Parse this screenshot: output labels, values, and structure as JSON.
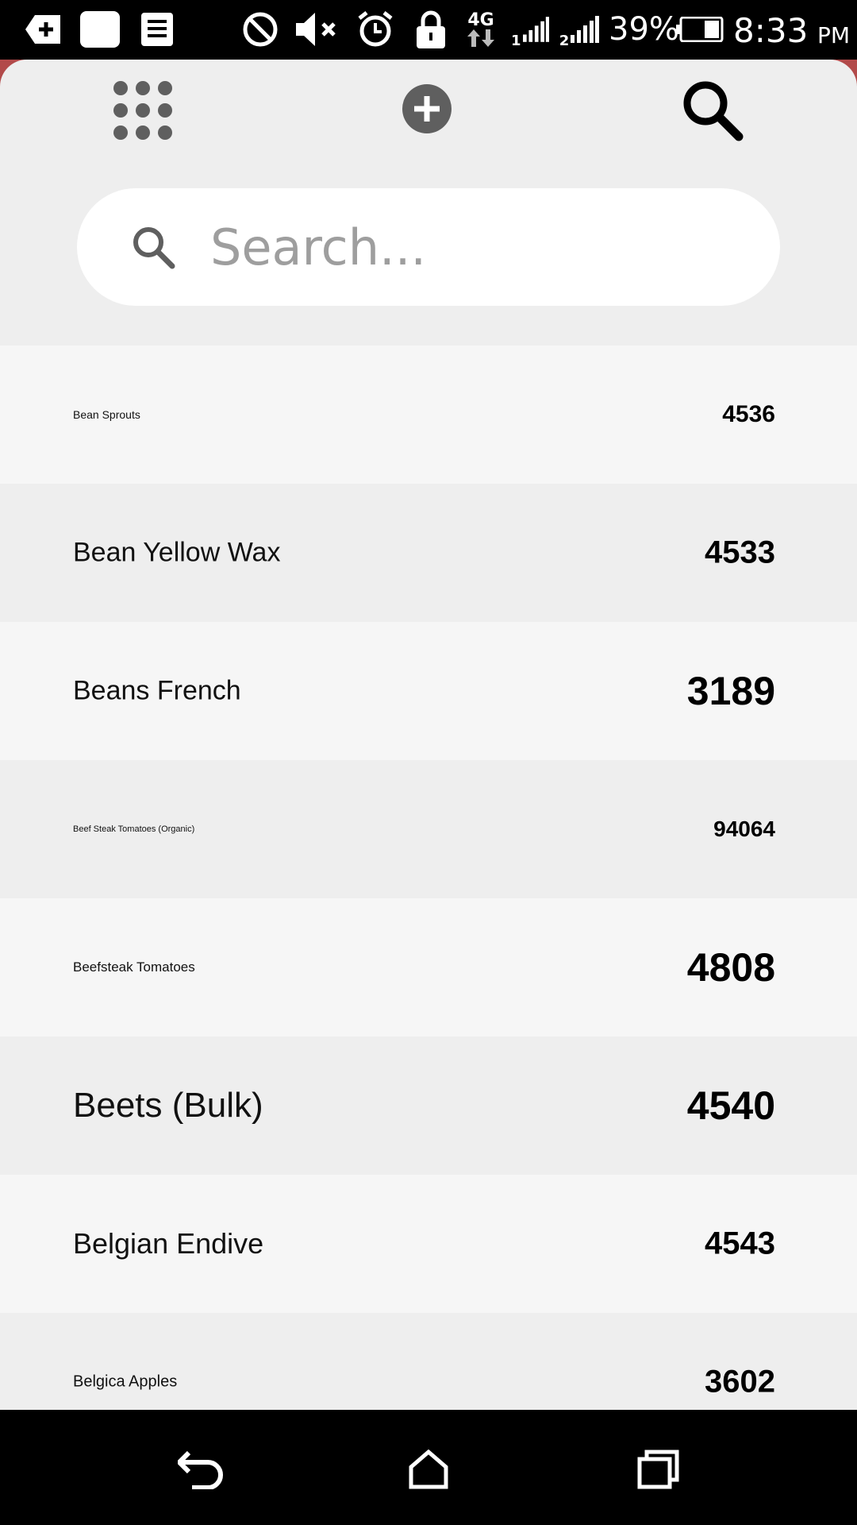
{
  "status_bar": {
    "icons": [
      "add-box-icon",
      "image-icon",
      "notes-icon",
      "do-not-disturb-icon",
      "mute-icon",
      "alarm-icon",
      "lock-icon",
      "4g-data-icon",
      "signal-sim1-icon",
      "signal-sim2-icon",
      "battery-icon"
    ],
    "network": "4G",
    "sim1": "1",
    "sim2": "2",
    "battery_percent": "39%",
    "time": "8:33",
    "ampm": "PM"
  },
  "toolbar": {
    "grid_icon": "grid-menu-icon",
    "add_icon": "add-circle-icon",
    "search_icon": "search-icon"
  },
  "search": {
    "placeholder": "Search..."
  },
  "items": [
    {
      "name": "Bean Sprouts",
      "code": "4536",
      "name_size": 14,
      "code_size": 30
    },
    {
      "name": "Bean Yellow Wax",
      "code": "4533",
      "name_size": 34,
      "code_size": 40
    },
    {
      "name": "Beans French",
      "code": "3189",
      "name_size": 34,
      "code_size": 50
    },
    {
      "name": "Beef Steak Tomatoes (Organic)",
      "code": "94064",
      "name_size": 11,
      "code_size": 28
    },
    {
      "name": "Beefsteak Tomatoes",
      "code": "4808",
      "name_size": 17,
      "code_size": 50
    },
    {
      "name": "Beets (Bulk)",
      "code": "4540",
      "name_size": 44,
      "code_size": 50
    },
    {
      "name": "Belgian Endive",
      "code": "4543",
      "name_size": 36,
      "code_size": 40
    },
    {
      "name": "Belgica Apples",
      "code": "3602",
      "name_size": 20,
      "code_size": 40
    }
  ],
  "nav_bar": {
    "back_icon": "back-icon",
    "home_icon": "home-icon",
    "recents_icon": "recents-icon"
  },
  "colors": {
    "background": "#eeeeee",
    "row_alt": "#f6f6f6",
    "icon_gray": "#5f5f5f",
    "placeholder": "#9e9e9e"
  }
}
